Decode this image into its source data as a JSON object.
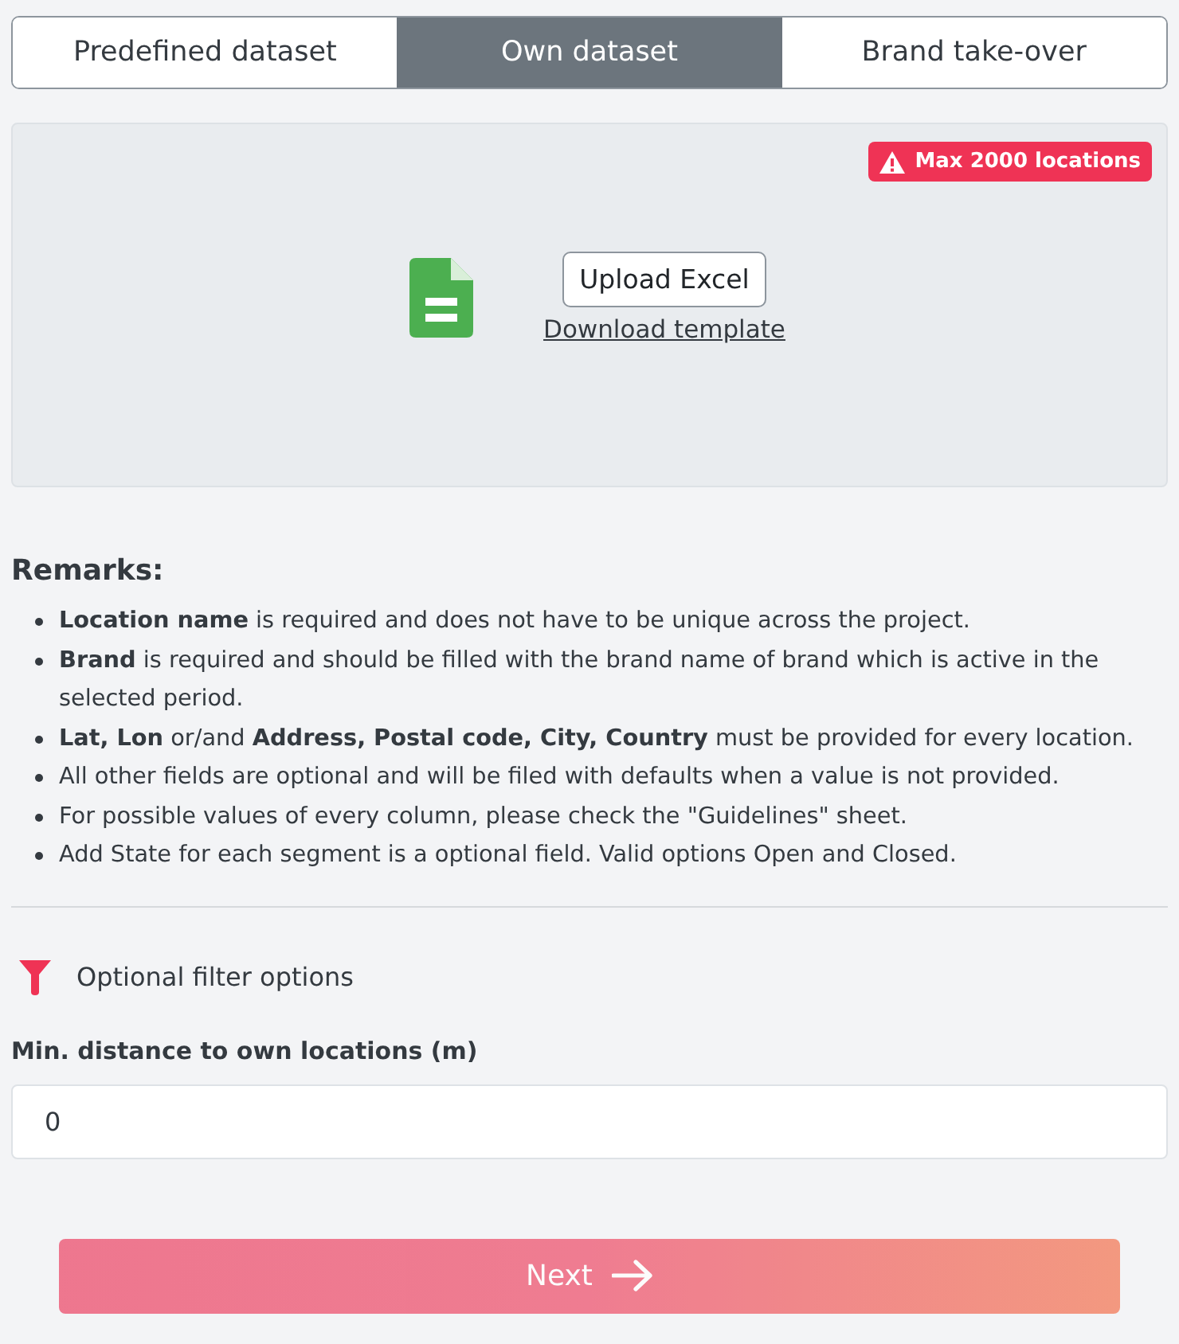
{
  "tabs": [
    {
      "label": "Predefined dataset",
      "selected": false
    },
    {
      "label": "Own dataset",
      "selected": true
    },
    {
      "label": "Brand take-over",
      "selected": false
    }
  ],
  "upload_panel": {
    "badge": {
      "text": "Max 2000 locations"
    },
    "upload_button": "Upload Excel",
    "template_link": "Download template"
  },
  "remarks": {
    "title": "Remarks:",
    "items": [
      "**Location name** is required and does not have to be unique across the project.",
      "**Brand** is required and should be filled with the brand name of brand which is active in the selected period.",
      "**Lat, Lon** or/and **Address, Postal code, City, Country** must be provided for every location.",
      "All other fields are optional and will be filed with defaults when a value is not provided.",
      "For possible values of every column, please check the \"Guidelines\" sheet.",
      "Add State for each segment is a optional field. Valid options Open and Closed."
    ]
  },
  "filter_section": {
    "title": "Optional filter options",
    "fields": [
      {
        "label": "Min. distance to own locations (m)",
        "value": "0"
      }
    ]
  },
  "next_button": {
    "label": "Next",
    "disabled": true
  }
}
